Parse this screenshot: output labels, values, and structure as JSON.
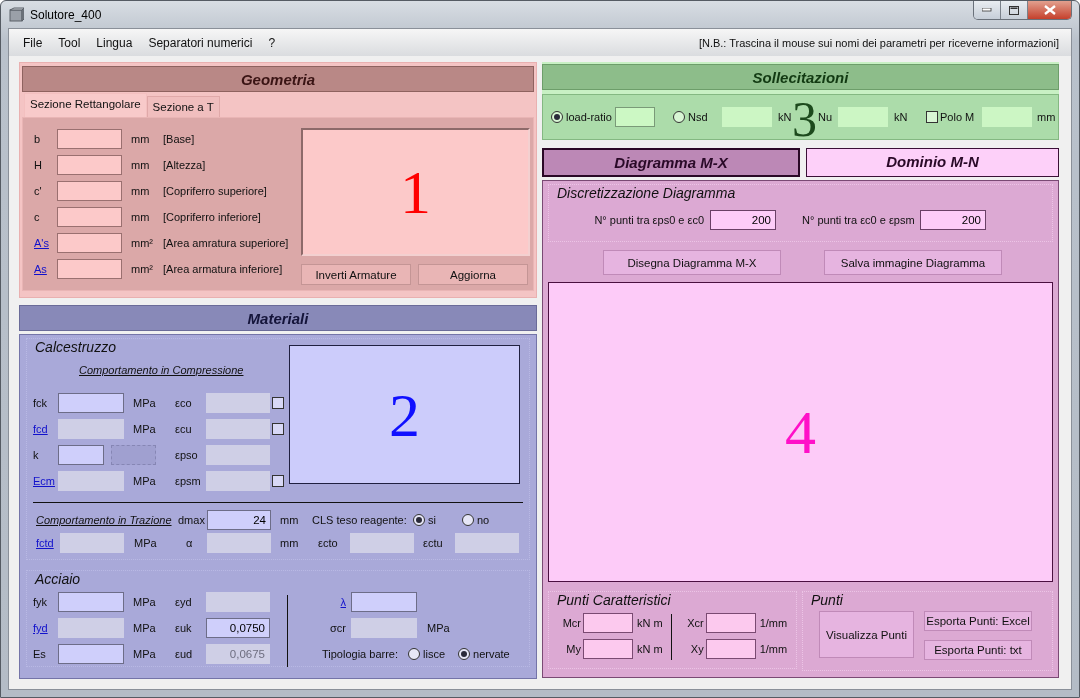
{
  "window": {
    "title": "Solutore_400"
  },
  "menu": [
    "File",
    "Tool",
    "Lingua",
    "Separatori numerici",
    "?"
  ],
  "hint": "[N.B.: Trascina il mouse sui nomi dei parametri per riceverne informazioni]",
  "geometria": {
    "title": "Geometria",
    "tabs": [
      {
        "label": "Sezione Rettangolare",
        "selected": true
      },
      {
        "label": "Sezione a T",
        "selected": false
      }
    ],
    "rows": [
      {
        "label": "b",
        "link": false,
        "unit": "mm",
        "description": "[Base]"
      },
      {
        "label": "H",
        "link": false,
        "unit": "mm",
        "description": "[Altezza]"
      },
      {
        "label": "c'",
        "link": false,
        "unit": "mm",
        "description": "[Copriferro superiore]"
      },
      {
        "label": "c",
        "link": false,
        "unit": "mm",
        "description": "[Copriferro inferiore]"
      },
      {
        "label": "A's",
        "link": true,
        "unit": "mm²",
        "description": "[Area amratura superiore]"
      },
      {
        "label": "As",
        "link": true,
        "unit": "mm²",
        "description": "[Area armatura inferiore]"
      }
    ],
    "preview_number": "1",
    "buttons": [
      "Inverti Armature",
      "Aggiorna"
    ]
  },
  "materiali": {
    "title": "Materiali",
    "calcestruzzo": {
      "title": "Calcestruzzo",
      "compression_heading": "Comportamento in Compressione",
      "rows": [
        [
          {
            "kind": "label",
            "text": "fck",
            "link": false
          },
          {
            "kind": "field",
            "disabled": false
          },
          {
            "kind": "unit",
            "text": "MPa"
          },
          {
            "kind": "label",
            "text": "εco",
            "link": false
          },
          {
            "kind": "field",
            "disabled": true
          },
          {
            "kind": "check",
            "checked": false
          }
        ],
        [
          {
            "kind": "label",
            "text": "fcd",
            "link": true
          },
          {
            "kind": "field",
            "disabled": true
          },
          {
            "kind": "unit",
            "text": "MPa"
          },
          {
            "kind": "label",
            "text": "εcu",
            "link": false
          },
          {
            "kind": "field",
            "disabled": true
          },
          {
            "kind": "check",
            "checked": false
          }
        ],
        [
          {
            "kind": "label",
            "text": "k",
            "link": false
          },
          {
            "kind": "short_field",
            "disabled": false
          },
          {
            "kind": "dashed_box"
          },
          {
            "kind": "label",
            "text": "εpso",
            "link": false
          },
          {
            "kind": "field",
            "disabled": true
          }
        ],
        [
          {
            "kind": "label",
            "text": "Ecm",
            "link": true
          },
          {
            "kind": "field",
            "disabled": true
          },
          {
            "kind": "unit",
            "text": "MPa"
          },
          {
            "kind": "label",
            "text": "εpsm",
            "link": false
          },
          {
            "kind": "field",
            "disabled": true
          },
          {
            "kind": "check",
            "checked": false
          }
        ]
      ],
      "preview_number": "2",
      "tension_rows": [
        [
          {
            "kind": "heading_link",
            "text": "Comportamento in Trazione"
          },
          {
            "kind": "label",
            "text": "dmax",
            "link": false
          },
          {
            "kind": "field",
            "disabled": false,
            "value": "24"
          },
          {
            "kind": "unit",
            "text": "mm"
          },
          {
            "kind": "label",
            "text": "CLS teso reagente:",
            "link": false
          },
          {
            "kind": "radio",
            "label": "si",
            "selected": true
          },
          {
            "kind": "radio",
            "label": "no",
            "selected": false
          }
        ],
        [
          {
            "kind": "label",
            "text": "fctd",
            "link": true
          },
          {
            "kind": "field",
            "disabled": true
          },
          {
            "kind": "unit",
            "text": "MPa"
          },
          {
            "kind": "label",
            "text": "α",
            "link": false
          },
          {
            "kind": "field",
            "disabled": true
          },
          {
            "kind": "unit",
            "text": "mm"
          },
          {
            "kind": "label",
            "text": "εcto",
            "link": false
          },
          {
            "kind": "field",
            "disabled": true
          },
          {
            "kind": "label",
            "text": "εctu",
            "link": false
          },
          {
            "kind": "field",
            "disabled": true
          }
        ]
      ]
    },
    "acciaio": {
      "title": "Acciaio",
      "left_rows": [
        [
          {
            "kind": "label",
            "text": "fyk",
            "link": false
          },
          {
            "kind": "field",
            "disabled": false
          },
          {
            "kind": "unit",
            "text": "MPa"
          },
          {
            "kind": "label",
            "text": "εyd",
            "link": false
          },
          {
            "kind": "field",
            "disabled": true
          }
        ],
        [
          {
            "kind": "label",
            "text": "fyd",
            "link": true
          },
          {
            "kind": "field",
            "disabled": true
          },
          {
            "kind": "unit",
            "text": "MPa"
          },
          {
            "kind": "label",
            "text": "εuk",
            "link": false
          },
          {
            "kind": "field",
            "disabled": false,
            "value": "0,0750"
          }
        ],
        [
          {
            "kind": "label",
            "text": "Es",
            "link": false
          },
          {
            "kind": "field",
            "disabled": false
          },
          {
            "kind": "unit",
            "text": "MPa"
          },
          {
            "kind": "label",
            "text": "εud",
            "link": false
          },
          {
            "kind": "field",
            "disabled": true,
            "value": "0,0675"
          }
        ]
      ],
      "right_rows": [
        [
          {
            "kind": "label",
            "text": "λ",
            "link": true
          },
          {
            "kind": "field",
            "disabled": false
          }
        ],
        [
          {
            "kind": "label",
            "text": "σcr",
            "link": false
          },
          {
            "kind": "field",
            "disabled": true
          },
          {
            "kind": "unit",
            "text": "MPa"
          }
        ],
        [
          {
            "kind": "label",
            "text": "Tipologia barre:",
            "link": false
          },
          {
            "kind": "radio",
            "label": "lisce",
            "selected": false
          },
          {
            "kind": "radio",
            "label": "nervate",
            "selected": true
          }
        ]
      ]
    }
  },
  "sollecitazioni": {
    "title": "Sollecitazioni",
    "items": [
      {
        "kind": "radio",
        "label": "load-ratio",
        "selected": true
      },
      {
        "kind": "field",
        "disabled": false
      },
      {
        "kind": "radio",
        "label": "Nsd",
        "selected": false
      },
      {
        "kind": "field",
        "disabled": true
      },
      {
        "kind": "unit",
        "text": "kN"
      },
      {
        "kind": "label",
        "text": "Nu",
        "link": false
      },
      {
        "kind": "field",
        "disabled": true
      },
      {
        "kind": "unit",
        "text": "kN"
      },
      {
        "kind": "check",
        "label": "Polo M",
        "checked": false
      },
      {
        "kind": "field",
        "disabled": true
      },
      {
        "kind": "unit",
        "text": "mm"
      }
    ],
    "overlay_number": "3"
  },
  "diagram_tabs": [
    {
      "label": "Diagramma M-X",
      "selected": true
    },
    {
      "label": "Dominio M-N",
      "selected": false
    }
  ],
  "diagramma": {
    "discretization": {
      "title": "Discretizzazione Diagramma",
      "items": [
        {
          "kind": "label",
          "text": "N° punti tra εps0 e εc0",
          "link": false
        },
        {
          "kind": "field",
          "disabled": false,
          "value": "200"
        },
        {
          "kind": "label",
          "text": "N° punti tra εc0 e εpsm",
          "link": false
        },
        {
          "kind": "field",
          "disabled": false,
          "value": "200"
        }
      ]
    },
    "buttons": [
      "Disegna Diagramma M-X",
      "Salva immagine Diagramma"
    ],
    "plot_number": "4",
    "characteristic_points": {
      "title": "Punti Caratteristici",
      "left_rows": [
        [
          {
            "kind": "label",
            "text": "Mcr",
            "link": false
          },
          {
            "kind": "field",
            "disabled": true
          },
          {
            "kind": "unit",
            "text": "kN m"
          }
        ],
        [
          {
            "kind": "label",
            "text": "My",
            "link": false
          },
          {
            "kind": "field",
            "disabled": true
          },
          {
            "kind": "unit",
            "text": "kN m"
          }
        ]
      ],
      "right_rows": [
        [
          {
            "kind": "label",
            "text": "Xcr",
            "link": false
          },
          {
            "kind": "field",
            "disabled": true
          },
          {
            "kind": "unit",
            "text": "1/mm"
          }
        ],
        [
          {
            "kind": "label",
            "text": "Xy",
            "link": false
          },
          {
            "kind": "field",
            "disabled": true
          },
          {
            "kind": "unit",
            "text": "1/mm"
          }
        ]
      ]
    },
    "points": {
      "title": "Punti",
      "main_button": "Visualizza Punti",
      "export_buttons": [
        "Esporta Punti: Excel",
        "Esporta Punti: txt"
      ]
    }
  }
}
